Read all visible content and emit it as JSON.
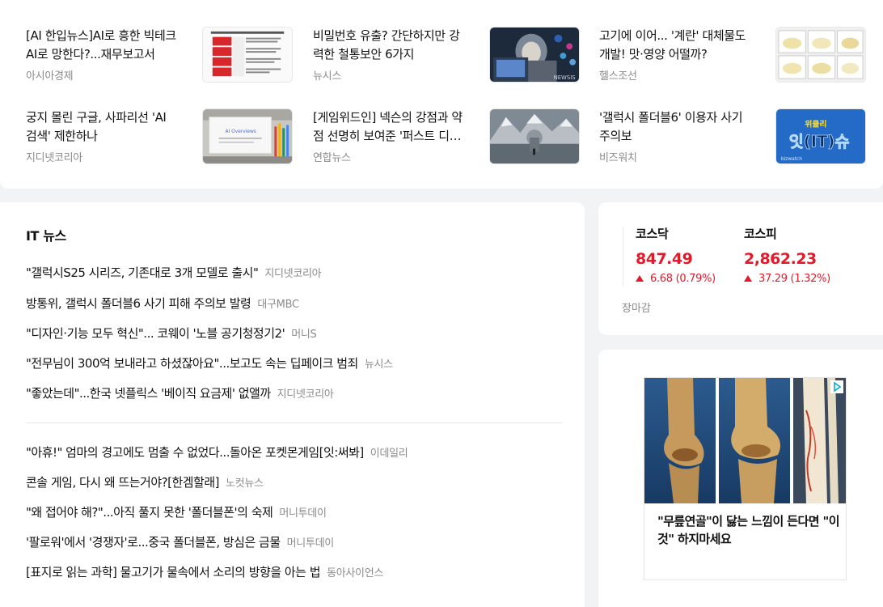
{
  "top_news": [
    {
      "title": "[AI 한입뉴스]AI로 흥한 빅테크 AI로 망한다?...재무보고서",
      "source": "아시아경제",
      "thumb": "document-table-thumbnail"
    },
    {
      "title": "비밀번호 유출? 간단하지만 강력한 철통보안 6가지",
      "source": "뉴시스",
      "thumb": "hooded-hacker-laptop-thumbnail"
    },
    {
      "title": "고기에 이어... '계란' 대체물도 개발! 맛·영양 어떨까?",
      "source": "헬스조선",
      "thumb": "egg-substitute-samples-thumbnail"
    },
    {
      "title": "궁지 몰린 구글, 사파리선 'AI 검색' 제한하나",
      "source": "지디넷코리아",
      "thumb": "ai-overviews-slide-thumbnail"
    },
    {
      "title": "[게임위드인] 넥슨의 강점과 약점 선명히 보여준 '퍼스트 디센던트'",
      "source": "연합뉴스",
      "thumb": "snowy-mountain-game-scene-thumbnail"
    },
    {
      "title": "'갤럭시 폴더블6' 이용자 사기 주의보",
      "source": "비즈워치",
      "thumb": "wiklar-itshow-logo-thumbnail"
    }
  ],
  "thumb_texts": {
    "ai_overviews": "AI Overviews",
    "wiklar_top": "위클리",
    "wiklar_main": "잇(IT)슈",
    "bizwatch": "bizwatch",
    "newsis": "NEWSIS"
  },
  "it_news": {
    "title": "IT 뉴스",
    "group1": [
      {
        "headline": "\"갤럭시S25 시리즈, 기존대로 3개 모델로 출시\"",
        "source": "지디넷코리아"
      },
      {
        "headline": "방통위, 갤럭시 폴더블6 사기 피해 주의보 발령",
        "source": "대구MBC"
      },
      {
        "headline": "\"디자인·기능 모두 혁신\"... 코웨이 '노블 공기청정기2'",
        "source": "머니S"
      },
      {
        "headline": "\"전무님이 300억 보내라고 하셨잖아요\"...보고도 속는 딥페이크 범죄",
        "source": "뉴시스"
      },
      {
        "headline": "\"좋았는데\"...한국 넷플릭스 '베이직 요금제' 없앨까",
        "source": "지디넷코리아"
      }
    ],
    "group2": [
      {
        "headline": "\"아휴!\" 엄마의 경고에도 멈출 수 없었다...돌아온 포켓몬게임[잇:써봐]",
        "source": "이데일리"
      },
      {
        "headline": "콘솔 게임, 다시 왜 뜨는거야?[한겜할래]",
        "source": "노컷뉴스"
      },
      {
        "headline": "\"왜 접어야 해?\"...아직 풀지 못한 '폴더블폰'의 숙제",
        "source": "머니투데이"
      },
      {
        "headline": "'팔로워'에서 '경쟁자'로...중국 폴더블폰, 방심은 금물",
        "source": "머니투데이"
      },
      {
        "headline": "[표지로 읽는 과학] 물고기가 물속에서 소리의 방향을 아는 법",
        "source": "동아사이언스"
      }
    ]
  },
  "stocks": {
    "kosdaq": {
      "name": "코스닥",
      "value": "847.49",
      "change": "6.68 (0.79%)",
      "direction": "up"
    },
    "kospi": {
      "name": "코스피",
      "value": "2,862.23",
      "change": "37.29 (1.32%)",
      "direction": "up"
    },
    "status": "장마감",
    "up_color": "#e5192a"
  },
  "ad": {
    "caption": "\"무릎연골\"이 닳는 느낌이 든다면 \"이것\" 하지마세요",
    "image": "knee-joint-xray-image",
    "badge": "adchoices-icon"
  }
}
